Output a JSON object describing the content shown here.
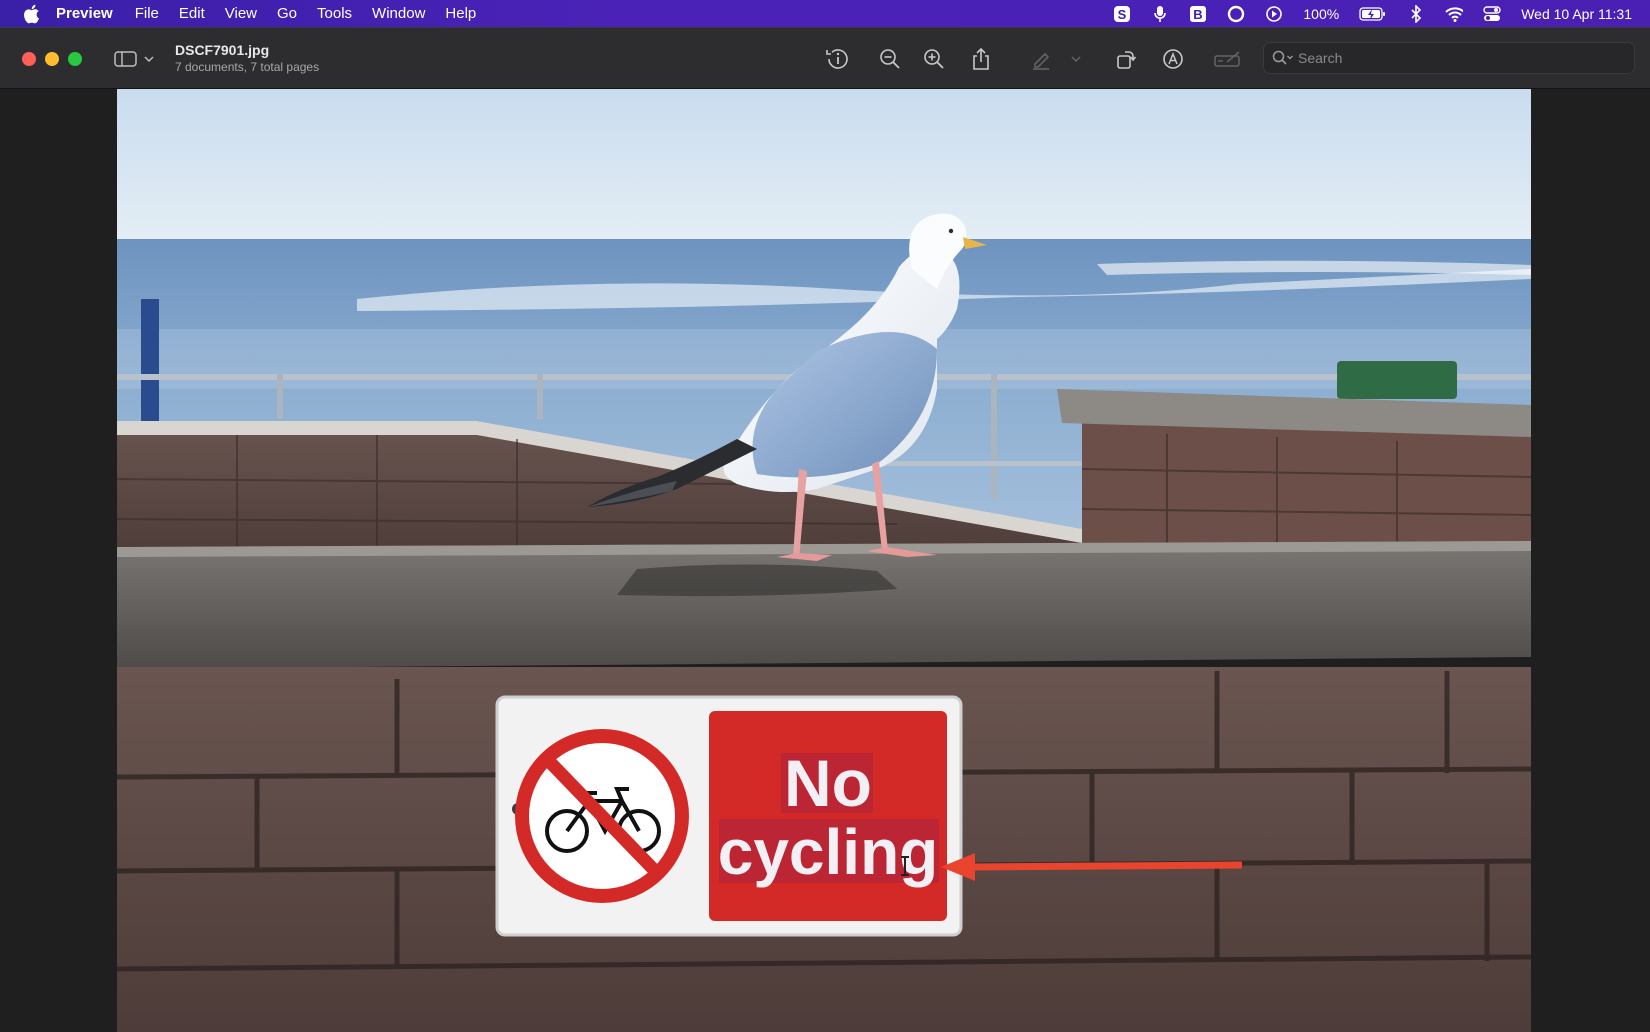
{
  "menubar": {
    "app_name": "Preview",
    "menus": [
      "File",
      "Edit",
      "View",
      "Go",
      "Tools",
      "Window",
      "Help"
    ],
    "status": {
      "battery_percent": "100%",
      "date_time": "Wed 10 Apr  11:31"
    }
  },
  "window": {
    "title": "DSCF7901.jpg",
    "subtitle": "7 documents, 7 total pages",
    "search_placeholder": "Search"
  },
  "photo": {
    "sign_line1": "No",
    "sign_line2": "cycling"
  },
  "colors": {
    "menubar": "#4320b0",
    "toolbar": "#2d2d2f",
    "sign_red": "#d42a27",
    "arrow": "#e8442e"
  }
}
